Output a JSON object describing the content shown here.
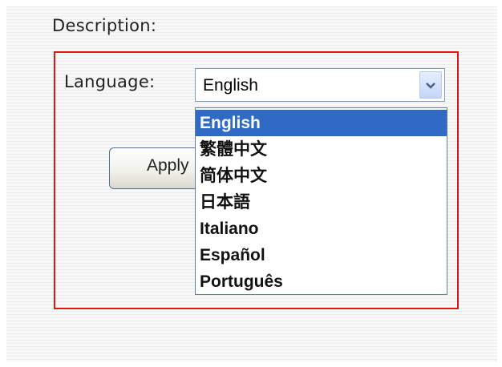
{
  "description_label": "Description:",
  "language": {
    "label": "Language:",
    "selected": "English",
    "options": [
      "English",
      "繁體中文",
      "简体中文",
      "日本語",
      "Italiano",
      "Español",
      "Português"
    ]
  },
  "apply_button_label": "Apply",
  "colors": {
    "border_highlight": "#e3131a",
    "selection": "#316ac5"
  }
}
